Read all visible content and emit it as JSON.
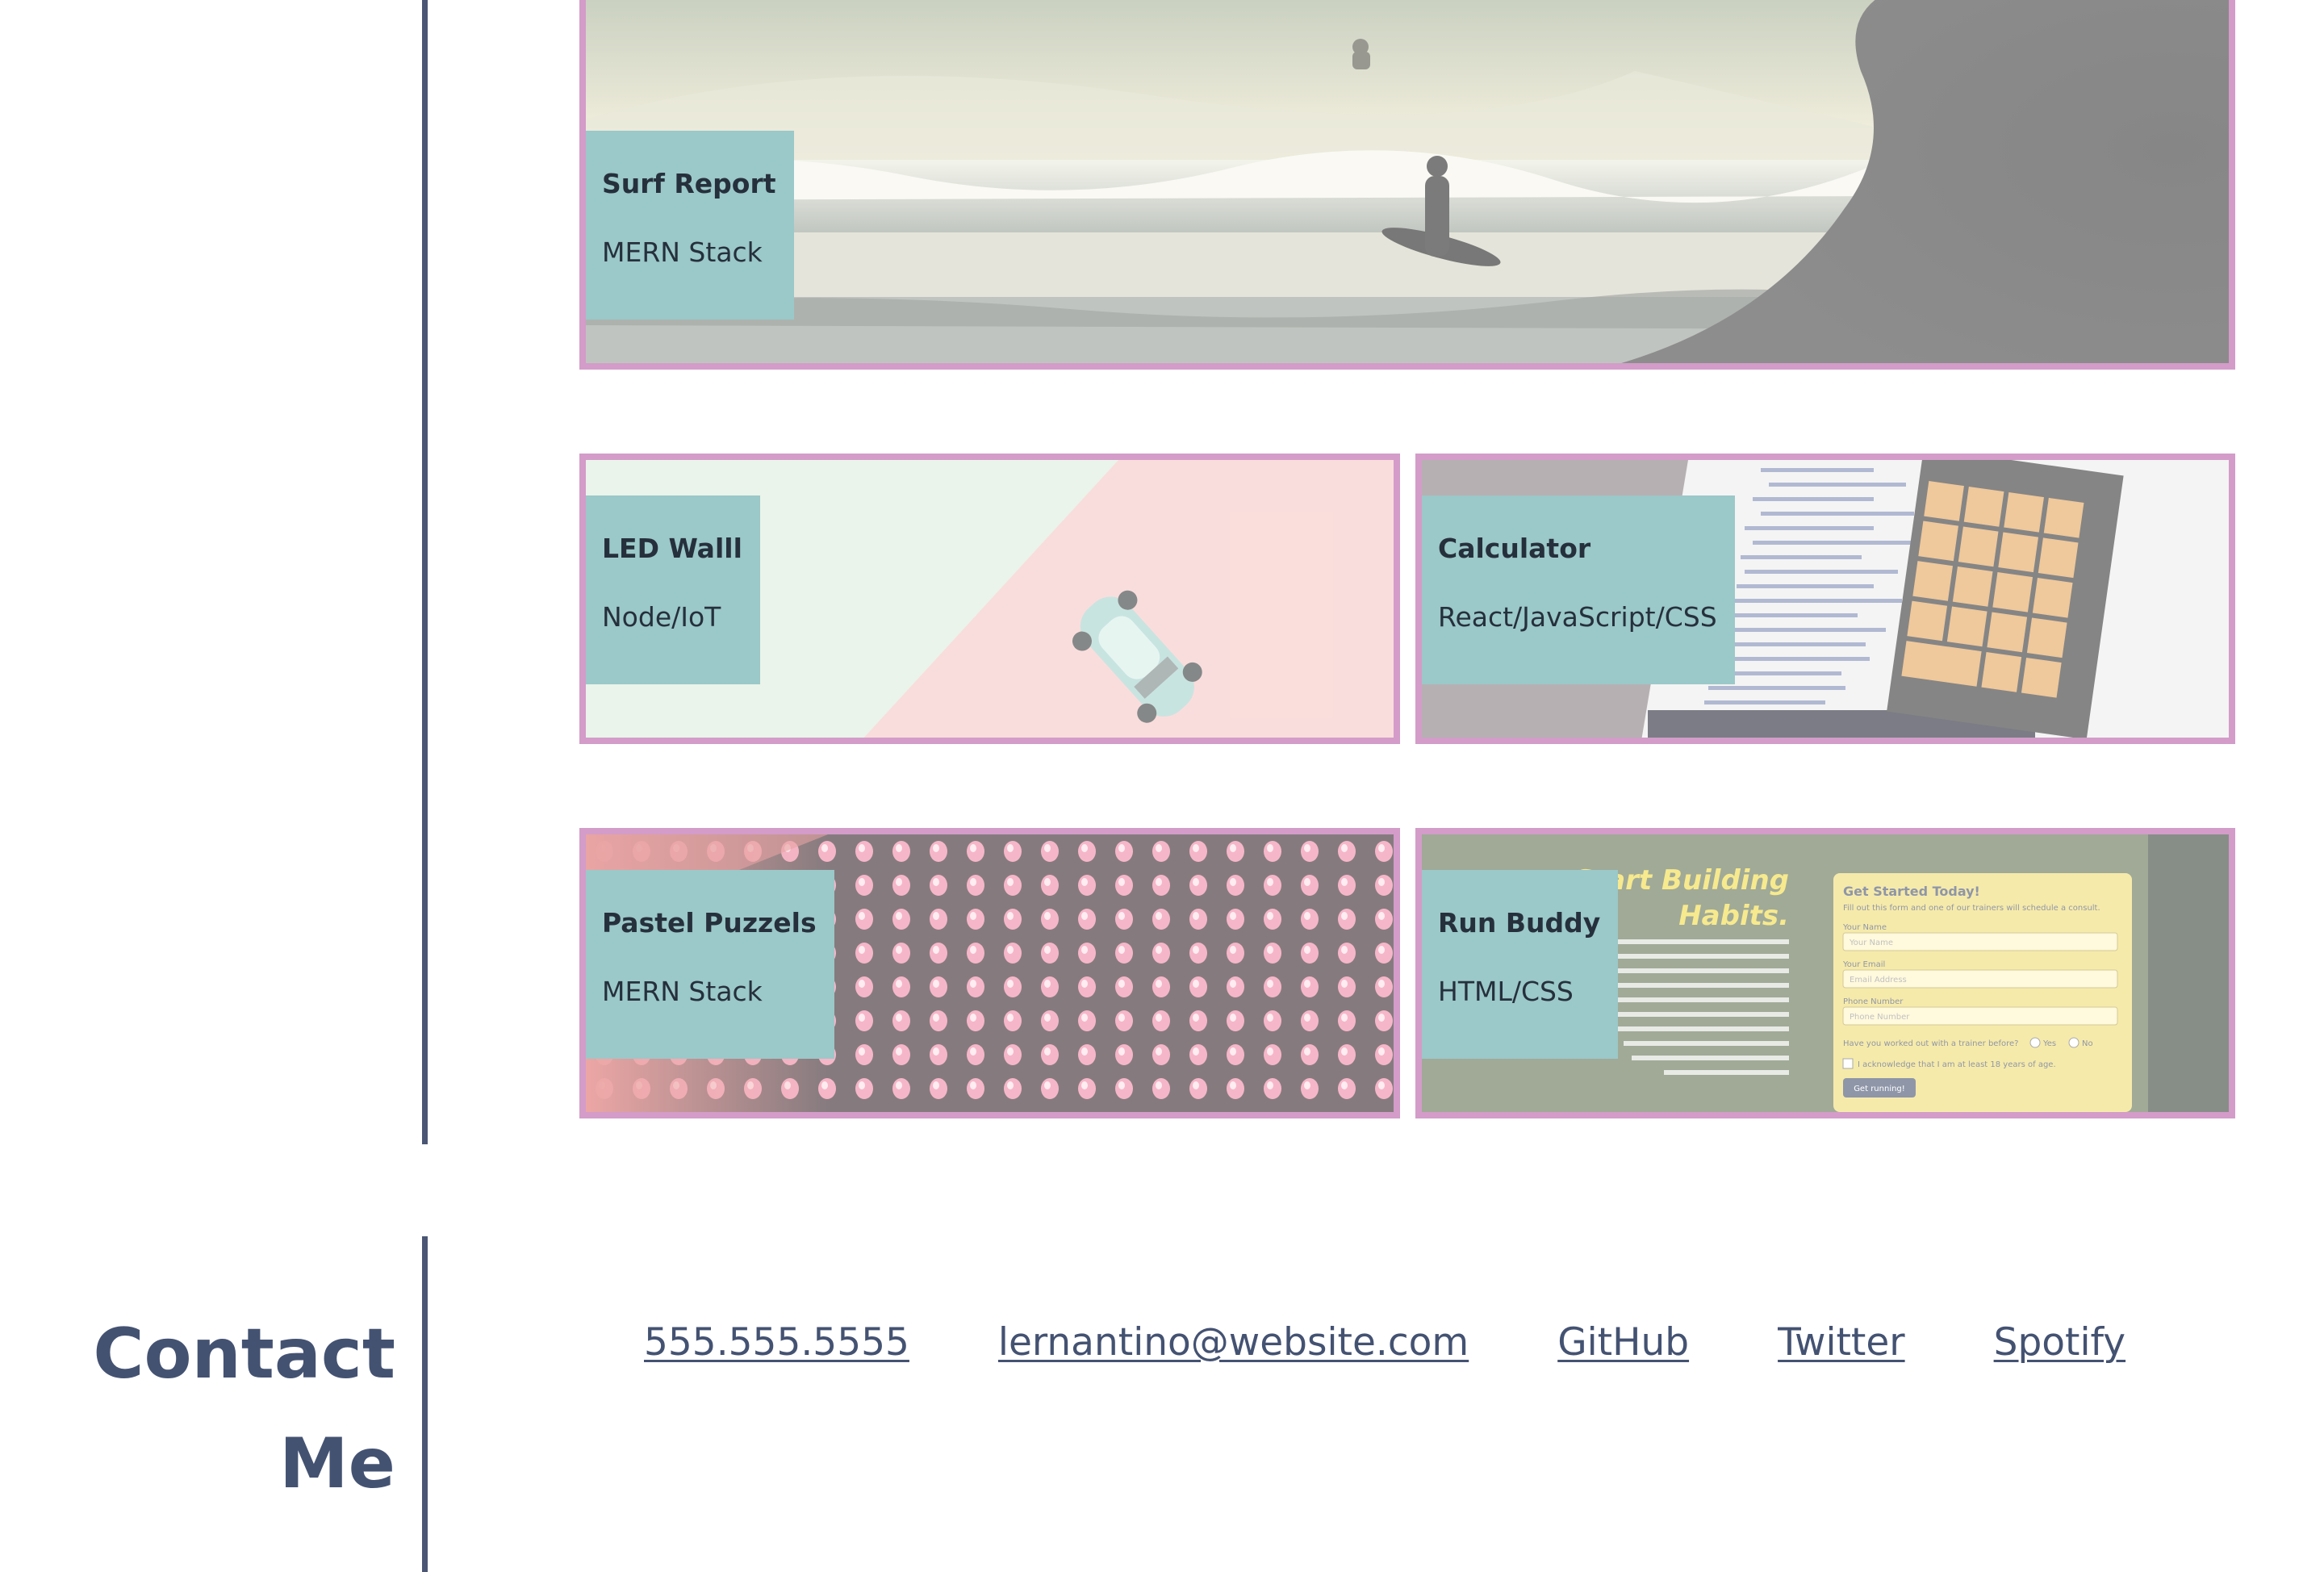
{
  "projects": [
    {
      "title": "Surf Report",
      "tech": "MERN Stack"
    },
    {
      "title": "LED Walll",
      "tech": "Node/IoT"
    },
    {
      "title": "Calculator",
      "tech": "React/JavaScript/CSS"
    },
    {
      "title": "Pastel Puzzels",
      "tech": "MERN Stack"
    },
    {
      "title": "Run Buddy",
      "tech": "HTML/CSS"
    }
  ],
  "run_buddy_screenshot": {
    "headline_1": "Start Building",
    "headline_2": "Habits.",
    "form_title": "Get Started Today!",
    "form_sub": "Fill out this form and one of our trainers will schedule a consult.",
    "name_label": "Your Name",
    "name_placeholder": "Your Name",
    "email_label": "Your Email",
    "email_placeholder": "Email Address",
    "phone_label": "Phone Number",
    "phone_placeholder": "Phone Number",
    "question": "Have you worked out with a trainer before?",
    "yes": "Yes",
    "no": "No",
    "ack": "I acknowledge that I am at least 18 years of age.",
    "submit": "Get running!"
  },
  "contact": {
    "heading_line1": "Contact",
    "heading_line2": "Me",
    "phone": "555.555.5555",
    "email": "lernantino@website.com",
    "github": "GitHub",
    "twitter": "Twitter",
    "spotify": "Spotify"
  },
  "colors": {
    "divider": "#4a5673",
    "card_border": "#d39cc9",
    "label_bg": "#9bc8c9",
    "heading": "#445272"
  }
}
